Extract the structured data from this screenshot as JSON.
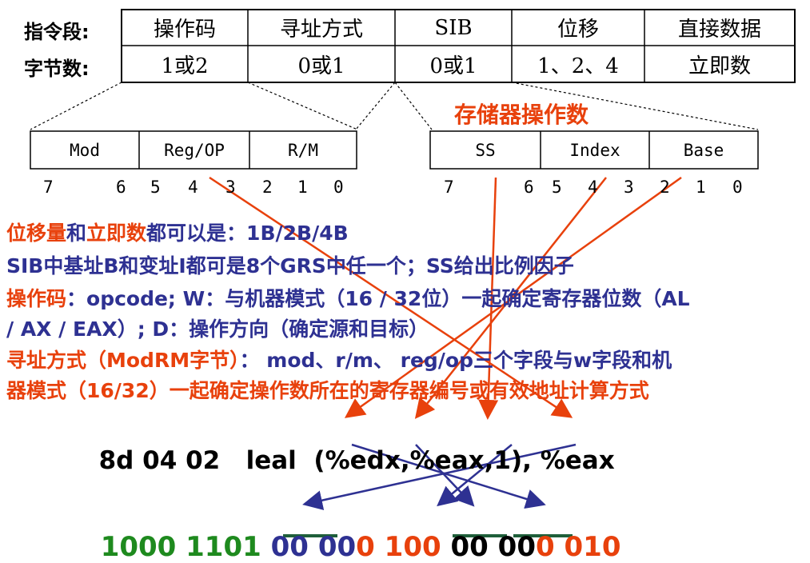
{
  "colors": {
    "red": "#e8410c",
    "blue": "#2e3192",
    "green": "#1e8a1e",
    "underline": "#1f5f3a"
  },
  "header": {
    "field_label": "指令段:",
    "bytes_label": "字节数:"
  },
  "format": {
    "fields": [
      "操作码",
      "寻址方式",
      "SIB",
      "位移",
      "直接数据"
    ],
    "bytes": [
      "1或2",
      "0或1",
      "0或1",
      "1、2、4",
      "立即数"
    ]
  },
  "modrm": {
    "fields": [
      "Mod",
      "Reg/OP",
      "R/M"
    ],
    "bits": [
      "7",
      "6",
      "5",
      "4",
      "3",
      "2",
      "1",
      "0"
    ]
  },
  "sib": {
    "title": "存储器操作数",
    "fields": [
      "SS",
      "Index",
      "Base"
    ],
    "bits": [
      "7",
      "6",
      "5",
      "4",
      "3",
      "2",
      "1",
      "0"
    ]
  },
  "notes": {
    "line1": {
      "a": "位移量",
      "b": "和",
      "c": "立即数",
      "d": "都可以是：1B/2B/4B"
    },
    "line2": "SIB中基址B和变址I都可是8个GRS中任一个；SS给出比例因子",
    "line3": {
      "a": "操作码",
      "b": "：opcode; W：与机器模式（16 / 32位）一起确定寄存器位数（AL"
    },
    "line4": "/ AX / EAX）; D：操作方向（确定源和目标）",
    "line5": {
      "a": "寻址方式（ModRM字节）",
      "b": "： mod、r/m、 reg/op三个字段与w字段和机"
    },
    "line6": "器模式（16/32）一起确定操作数所在的寄存器编号或有效地址计算方式"
  },
  "example": {
    "hex": "8d 04 02",
    "mnemonic": "leal",
    "operands": "(%edx,%eax,1), %eax"
  },
  "binary": {
    "opcode": "1000 1101",
    "mod": "00",
    "reg_a": "00",
    "reg_b": "0",
    "rm": "100",
    "ss": "00",
    "index_a": "00",
    "index_b": "0",
    "base": "010"
  }
}
